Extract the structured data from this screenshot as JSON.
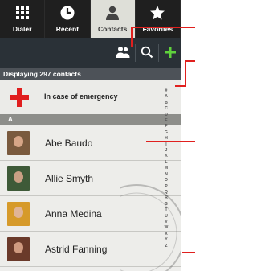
{
  "tabs": [
    {
      "label": "Dialer",
      "icon": "dialpad-icon"
    },
    {
      "label": "Recent",
      "icon": "clock-icon"
    },
    {
      "label": "Contacts",
      "icon": "person-icon"
    },
    {
      "label": "Favorites",
      "icon": "star-icon"
    }
  ],
  "active_tab": "Contacts",
  "actionbar": {
    "icons": [
      "groups-icon",
      "search-icon",
      "add-contact-icon"
    ]
  },
  "count_text": "Displaying 297 contacts",
  "emergency": {
    "label": "In case of emergency"
  },
  "section_letter": "A",
  "contacts": [
    {
      "name": "Abe Baudo"
    },
    {
      "name": "Allie Smyth"
    },
    {
      "name": "Anna Medina"
    },
    {
      "name": "Astrid Fanning"
    }
  ],
  "alpha_index": [
    "#",
    "A",
    "B",
    "C",
    "D",
    "E",
    "F",
    "G",
    "H",
    "I",
    "J",
    "K",
    "L",
    "M",
    "N",
    "O",
    "P",
    "Q",
    "R",
    "S",
    "T",
    "U",
    "V",
    "W",
    "X",
    "Y",
    "Z"
  ],
  "colors": {
    "accent_red": "#e0201e",
    "plus_green": "#5fd23c",
    "tabbar": "#1f1f1f",
    "actionbar": "#2a3137"
  }
}
